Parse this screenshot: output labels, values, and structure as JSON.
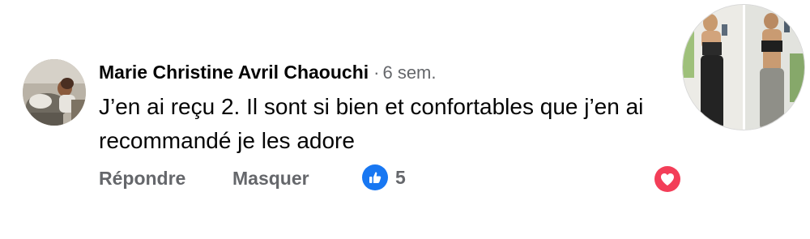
{
  "comment": {
    "author": "Marie Christine Avril Chaouchi",
    "separator": "·",
    "time": "6 sem.",
    "text": "J’en ai reçu 2. Il sont si bien et confortables que j’en ai recommandé je les adore"
  },
  "actions": {
    "reply_label": "Répondre",
    "hide_label": "Masquer",
    "reaction_icon": "thumbs-up-icon",
    "reaction_count": "5",
    "react_icon": "heart-icon"
  },
  "colors": {
    "like_blue": "#1877f2",
    "heart_red": "#f33e58",
    "secondary_text": "#65676b",
    "primary_text": "#050505"
  }
}
